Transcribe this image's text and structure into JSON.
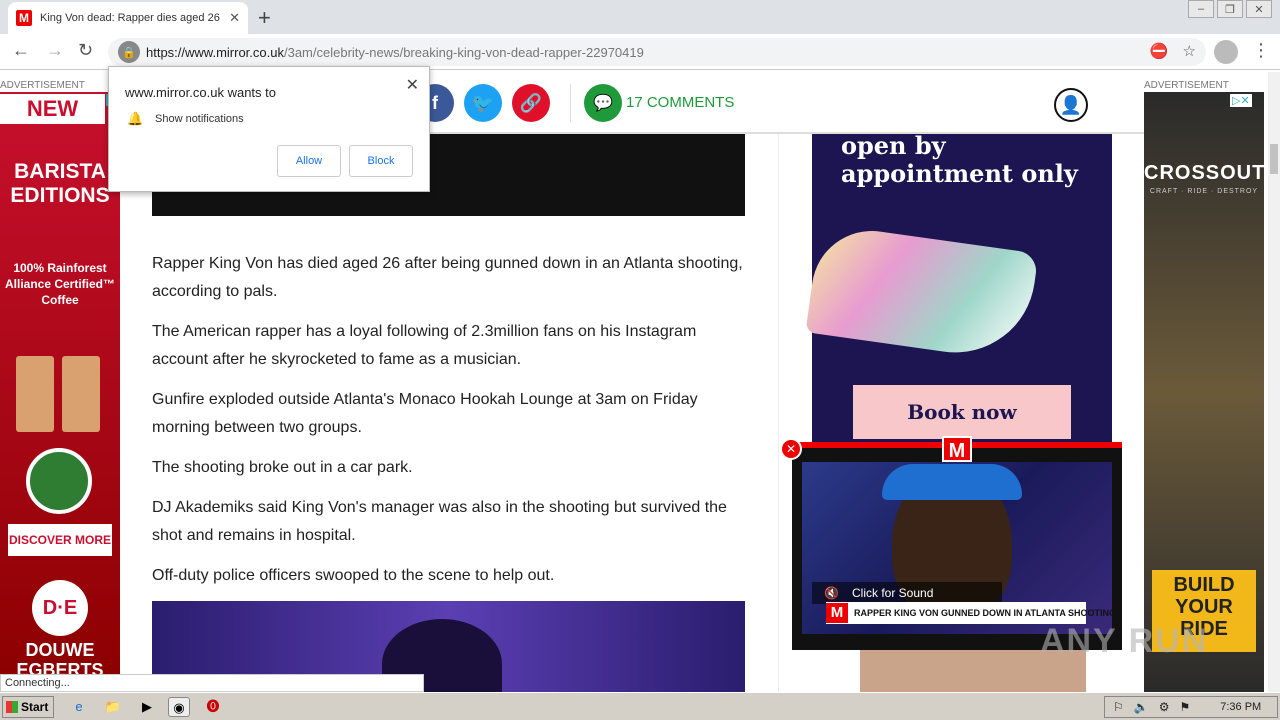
{
  "browser": {
    "tab_title": "King Von dead: Rapper dies aged 26",
    "url_domain": "https://www.mirror.co.uk",
    "url_path": "/3am/celebrity-news/breaking-king-von-dead-rapper-22970419"
  },
  "ads": {
    "left_label": "ADVERTISEMENT",
    "right_label": "ADVERTISEMENT",
    "left_new": "NEW",
    "left_headline": "BARISTA EDITIONS",
    "left_sub": "100% Rainforest Alliance Certified™ Coffee",
    "left_cta": "DISCOVER MORE",
    "left_logo": "D·E",
    "left_brand": "DOUWE EGBERTS",
    "right_brand": "CROSSOUT",
    "right_sub": "CRAFT · RIDE · DESTROY",
    "right_cta": "BUILD YOUR RIDE"
  },
  "header": {
    "comments": "17 COMMENTS"
  },
  "article": {
    "paragraphs": [
      "Rapper King Von has died aged 26 after being gunned down in an Atlanta shooting, according to pals.",
      "The American rapper has a loyal following of 2.3million fans on his Instagram account after he skyrocketed to fame as a musician.",
      "Gunfire exploded outside Atlanta's Monaco Hookah Lounge at 3am on Friday morning between two groups.",
      "The shooting broke out in a car park.",
      "DJ Akademiks said King Von's manager was also in the shooting but survived the shot and remains in hospital.",
      "Off-duty police officers swooped to the scene to help out."
    ]
  },
  "sidebar_ad": {
    "text": "open by appointment only",
    "cta": "Book now"
  },
  "video": {
    "sound_label": "Click for Sound",
    "headline": "RAPPER KING VON GUNNED DOWN IN ATLANTA SHOOTING",
    "logo": "M"
  },
  "popup": {
    "title": "www.mirror.co.uk wants to",
    "desc": "Show notifications",
    "allow": "Allow",
    "block": "Block"
  },
  "status": "Connecting...",
  "taskbar": {
    "start": "Start",
    "time": "7:36 PM"
  },
  "watermark": "ANY RUN"
}
